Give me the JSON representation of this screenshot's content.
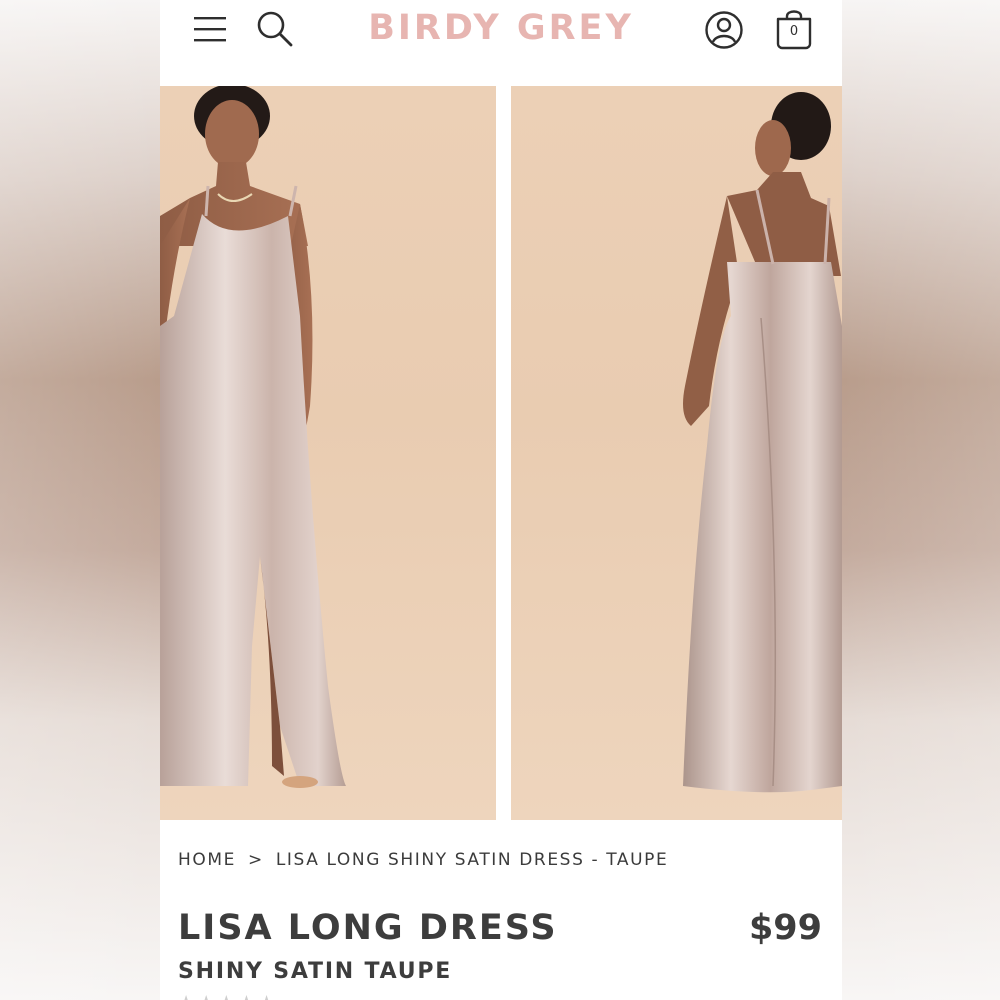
{
  "header": {
    "logo_text": "BIRDY GREY",
    "cart_count": "0",
    "icons": [
      "menu-icon",
      "search-icon",
      "account-icon",
      "cart-icon"
    ]
  },
  "gallery": {
    "images": [
      {
        "view": "front",
        "alt": "LISA LONG SHINY SATIN DRESS - TAUPE front"
      },
      {
        "view": "back",
        "alt": "LISA LONG SHINY SATIN DRESS - TAUPE back"
      }
    ]
  },
  "breadcrumb": {
    "home": "HOME",
    "separator": ">",
    "current": "LISA LONG SHINY SATIN DRESS - TAUPE"
  },
  "product": {
    "title": "LISA LONG DRESS",
    "subtitle": "SHINY SATIN TAUPE",
    "price": "$99",
    "rating_stars": "★★★★★"
  },
  "colors": {
    "logo": "#e7b5b1",
    "text": "#3d3d3d",
    "backdrop": "#ecd0b6",
    "dress": "#cdb5ad"
  }
}
